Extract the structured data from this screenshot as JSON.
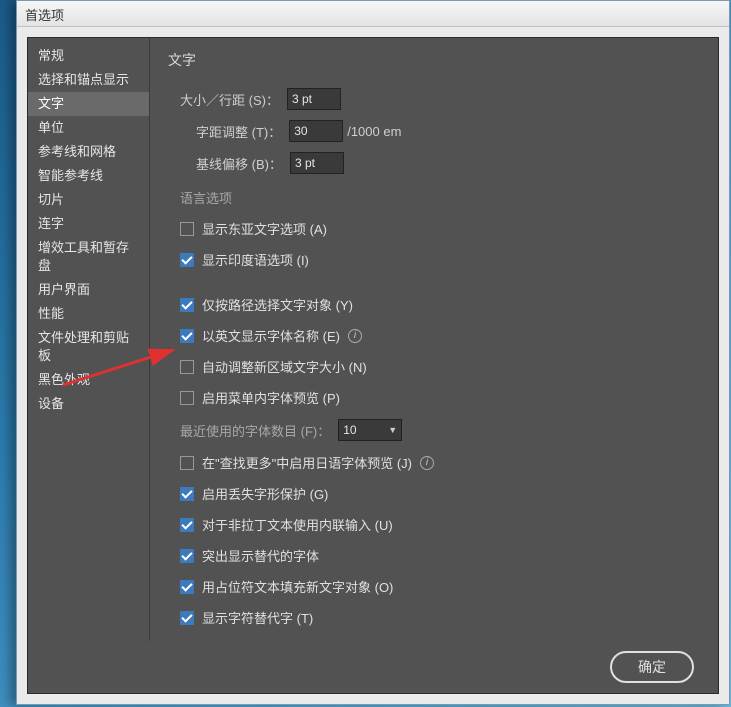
{
  "window": {
    "title": "首选项"
  },
  "sidebar": {
    "items": [
      {
        "label": "常规"
      },
      {
        "label": "选择和锚点显示"
      },
      {
        "label": "文字",
        "active": true
      },
      {
        "label": "单位"
      },
      {
        "label": "参考线和网格"
      },
      {
        "label": "智能参考线"
      },
      {
        "label": "切片"
      },
      {
        "label": "连字"
      },
      {
        "label": "增效工具和暂存盘"
      },
      {
        "label": "用户界面"
      },
      {
        "label": "性能"
      },
      {
        "label": "文件处理和剪贴板"
      },
      {
        "label": "黑色外观"
      },
      {
        "label": "设备"
      }
    ]
  },
  "main": {
    "title": "文字",
    "size_leading": {
      "label": "大小／行距 (S)：",
      "value": "3 pt"
    },
    "tracking": {
      "label": "字距调整 (T)：",
      "value": "30",
      "unit": "/1000 em"
    },
    "baseline": {
      "label": "基线偏移 (B)：",
      "value": "3 pt"
    },
    "lang_group": "语言选项",
    "chk_east_asian": {
      "label": "显示东亚文字选项 (A)",
      "checked": false
    },
    "chk_indic": {
      "label": "显示印度语选项 (I)",
      "checked": true
    },
    "chk_path_only": {
      "label": "仅按路径选择文字对象 (Y)",
      "checked": true
    },
    "chk_english_fontname": {
      "label": "以英文显示字体名称 (E)",
      "checked": true
    },
    "chk_auto_size_area": {
      "label": "自动调整新区域文字大小 (N)",
      "checked": false
    },
    "chk_menu_preview": {
      "label": "启用菜单内字体预览 (P)",
      "checked": false
    },
    "recent_fonts": {
      "label": "最近使用的字体数目 (F)：",
      "value": "10"
    },
    "chk_jp_preview": {
      "label": "在\"查找更多\"中启用日语字体预览 (J)",
      "checked": false
    },
    "chk_missing_glyph": {
      "label": "启用丢失字形保护 (G)",
      "checked": true
    },
    "chk_inline_input": {
      "label": "对于非拉丁文本使用内联输入 (U)",
      "checked": true
    },
    "chk_highlight_alt": {
      "label": "突出显示替代的字体",
      "checked": true
    },
    "chk_placeholder": {
      "label": "用占位符文本填充新文字对象 (O)",
      "checked": true
    },
    "chk_show_alt_glyph": {
      "label": "显示字符替代字 (T)",
      "checked": true
    }
  },
  "footer": {
    "ok": "确定"
  }
}
